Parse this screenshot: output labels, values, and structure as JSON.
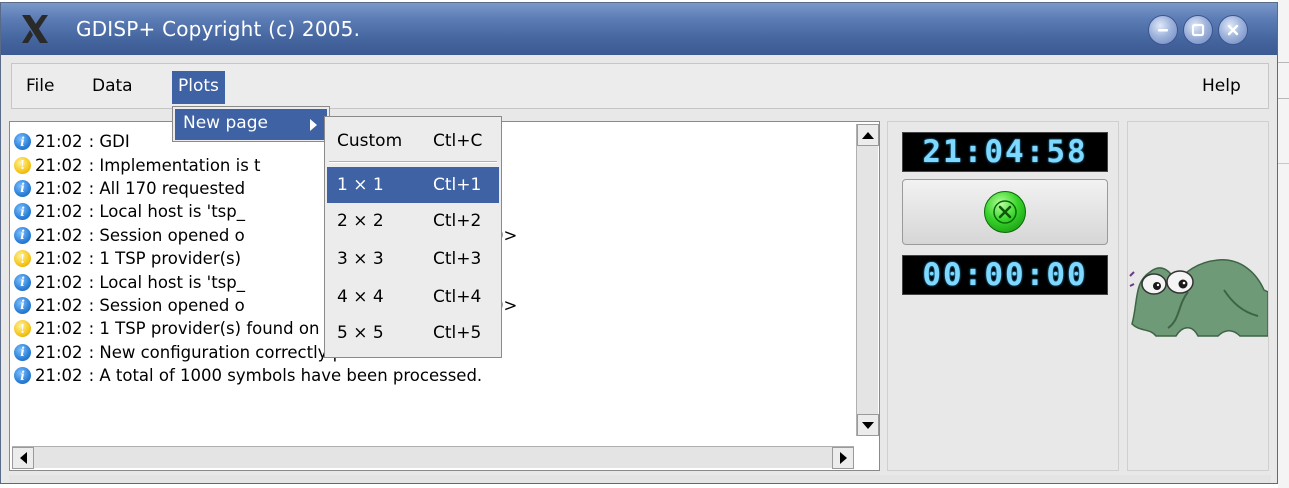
{
  "window": {
    "title": "GDISP+ Copyright (c) 2005."
  },
  "menubar": {
    "file": "File",
    "data": "Data",
    "plots": "Plots",
    "help": "Help"
  },
  "plots_menu": {
    "items": [
      {
        "label": "New page",
        "has_submenu": true
      }
    ]
  },
  "new_page_submenu": {
    "items": [
      {
        "label": "Custom",
        "shortcut": "Ctl+C",
        "highlighted": false
      },
      {
        "label": "1 × 1",
        "shortcut": "Ctl+1",
        "highlighted": true
      },
      {
        "label": "2 × 2",
        "shortcut": "Ctl+2",
        "highlighted": false
      },
      {
        "label": "3 × 3",
        "shortcut": "Ctl+3",
        "highlighted": false
      },
      {
        "label": "4 × 4",
        "shortcut": "Ctl+4",
        "highlighted": false
      },
      {
        "label": "5 × 5",
        "shortcut": "Ctl+5",
        "highlighted": false
      }
    ]
  },
  "log": {
    "entries": [
      {
        "type": "info",
        "time": "21:02",
        "text": ": GDI"
      },
      {
        "type": "warn",
        "time": "21:02",
        "text": ": Implementation is t"
      },
      {
        "type": "info",
        "time": "21:02",
        "text": ": All 170 requested                       allocated."
      },
      {
        "type": "info",
        "time": "21:02",
        "text": ": Local host is 'tsp_"
      },
      {
        "type": "info",
        "time": "21:02",
        "text": ": Session opened o                      'StubbedServer:0>"
      },
      {
        "type": "warn",
        "time": "21:02",
        "text": ": 1 TSP provider(s)                      demo."
      },
      {
        "type": "info",
        "time": "21:02",
        "text": ": Local host is 'tsp_"
      },
      {
        "type": "info",
        "time": "21:02",
        "text": ": Session opened o                      'StubbedServer:0>"
      },
      {
        "type": "warn",
        "time": "21:02",
        "text": ": 1 TSP provider(s) found on host tsp_demo."
      },
      {
        "type": "info",
        "time": "21:02",
        "text": ": New configuration correctly performed."
      },
      {
        "type": "info",
        "time": "21:02",
        "text": ": A total of 1000 symbols have been processed."
      }
    ]
  },
  "clock": {
    "time_display": "21:04:58",
    "elapsed_display": "00:00:00",
    "run_icon": "green-close-icon"
  },
  "icons": {
    "info": "info-icon",
    "warn": "warning-icon"
  },
  "colors": {
    "titlebar": "#4a6aa8",
    "selection": "#3e62a3",
    "lcd_text": "#7fd8ff"
  }
}
